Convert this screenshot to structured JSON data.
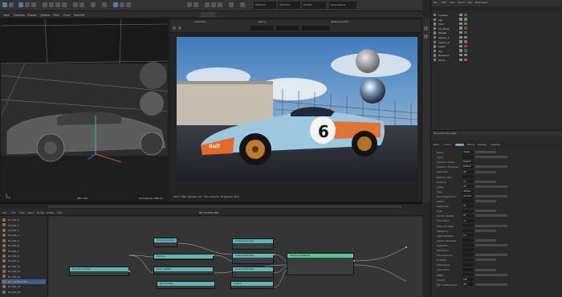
{
  "colors": {
    "accent": "#4a7fb8",
    "node_teal": "#5fb5b5",
    "node_green": "#58c892",
    "car_blue": "#9bc7e0",
    "car_orange": "#e56b24"
  },
  "topbar": {
    "icons": [
      "cube-icon",
      "sphere-icon",
      "camera-icon",
      "light-icon",
      "brush-icon",
      "paint-icon",
      "grid-icon",
      "render-icon"
    ],
    "fields": [
      "Standard",
      "Standard",
      "Default",
      "Node Spaces"
    ]
  },
  "menubar": {
    "items": [
      "View",
      "Cameras",
      "Display",
      "Options",
      "Filter",
      "Panel",
      "Redshift"
    ]
  },
  "left_viewport": {
    "label": "Perspective",
    "footer_left": "360 x 220",
    "footer_right": "Grid Spacing: 1000 cm"
  },
  "render_view": {
    "header_tabs": [
      "Snapshots",
      "Beauty",
      "Redshift Camera"
    ],
    "footer_text": "1920 x 1080 · Samples: 512 · Time: 00:02:35 · Progressive: 100%",
    "car_number": "6",
    "car_sponsor": "Gulf"
  },
  "node_editor": {
    "title": "RS C Surface Mat",
    "menu": [
      "File",
      "Edit",
      "View",
      "Select",
      "Nodes",
      "Create",
      "Help"
    ],
    "layers": [
      "RS_Mat_1",
      "RS_Mat_2",
      "RS_Mat_3",
      "RS_Mat_4",
      "RS_Mat_5",
      "RS_Mat_6",
      "RS_Mat_7",
      "RS_Mat_8",
      "RS_Mat_9",
      "RS_Mat_10",
      "RS_Mat_11",
      "RS_Mat_12",
      "RS C Surface Mat",
      "RS_Mat_14",
      "RS_Mat_15"
    ],
    "nodes": {
      "n1": "Texture Sampler",
      "n2": "Texture",
      "n3": "RS Color Correct",
      "n4": "Output Standard",
      "n5": "Output Standard",
      "n6": "Output Standard",
      "n7": "Standard Material",
      "n8": "Color Splitter",
      "n9": "Normal Map",
      "n10": "Output"
    }
  },
  "right_panel": {
    "menu": [
      "File",
      "Edit",
      "View",
      "Object",
      "Tags",
      "Bookmarks"
    ],
    "objects": [
      "Camera",
      "Sky",
      "Floor",
      "Car_Body",
      "Wheels",
      "Sphere_1",
      "Sphere_2",
      "Lights",
      "Rig",
      "Backdrop",
      "Fence"
    ],
    "attr_title": "Mode  Edit  User Data",
    "attr_tabs": [
      "Basic",
      "Coord.",
      "Object",
      "Phong",
      "Display",
      "Shading"
    ],
    "attributes": [
      {
        "label": "Name",
        "value": "Image"
      },
      {
        "label": "Layer",
        "value": ""
      },
      {
        "label": "Visible in Editor",
        "value": "Default"
      },
      {
        "label": "Visible in Renderer",
        "value": "Default"
      },
      {
        "label": "Use Color",
        "value": "Off"
      },
      {
        "label": "Display Color",
        "value": ""
      },
      {
        "label": "Enabled",
        "value": "On"
      },
      {
        "label": "X-Ray",
        "value": "Off"
      },
      {
        "label": "Type",
        "value": "Infinite"
      },
      {
        "label": "Normal Direction",
        "value": "Outside"
      },
      {
        "label": "Radius",
        "value": ""
      },
      {
        "label": "Segments",
        "value": "24"
      },
      {
        "label": "Fillet",
        "value": ""
      },
      {
        "label": "Render Perfect",
        "value": "On"
      },
      {
        "label": "Orientation",
        "value": "+Y"
      },
      {
        "label": "Show Normals",
        "value": ""
      },
      {
        "label": "Sampling",
        "value": ""
      },
      {
        "label": "Light Samples",
        "value": "16"
      },
      {
        "label": "Volume Samples",
        "value": ""
      },
      {
        "label": "Reflection",
        "value": ""
      },
      {
        "label": "Refraction",
        "value": ""
      },
      {
        "label": "Transparency",
        "value": ""
      },
      {
        "label": "Caustics",
        "value": ""
      },
      {
        "label": "Subsurface",
        "value": ""
      },
      {
        "label": "Volumetric",
        "value": ""
      },
      {
        "label": "Matte",
        "value": ""
      },
      {
        "label": "Priority",
        "value": "100"
      },
      {
        "label": "Max Subdivisions",
        "value": "Off"
      }
    ]
  }
}
